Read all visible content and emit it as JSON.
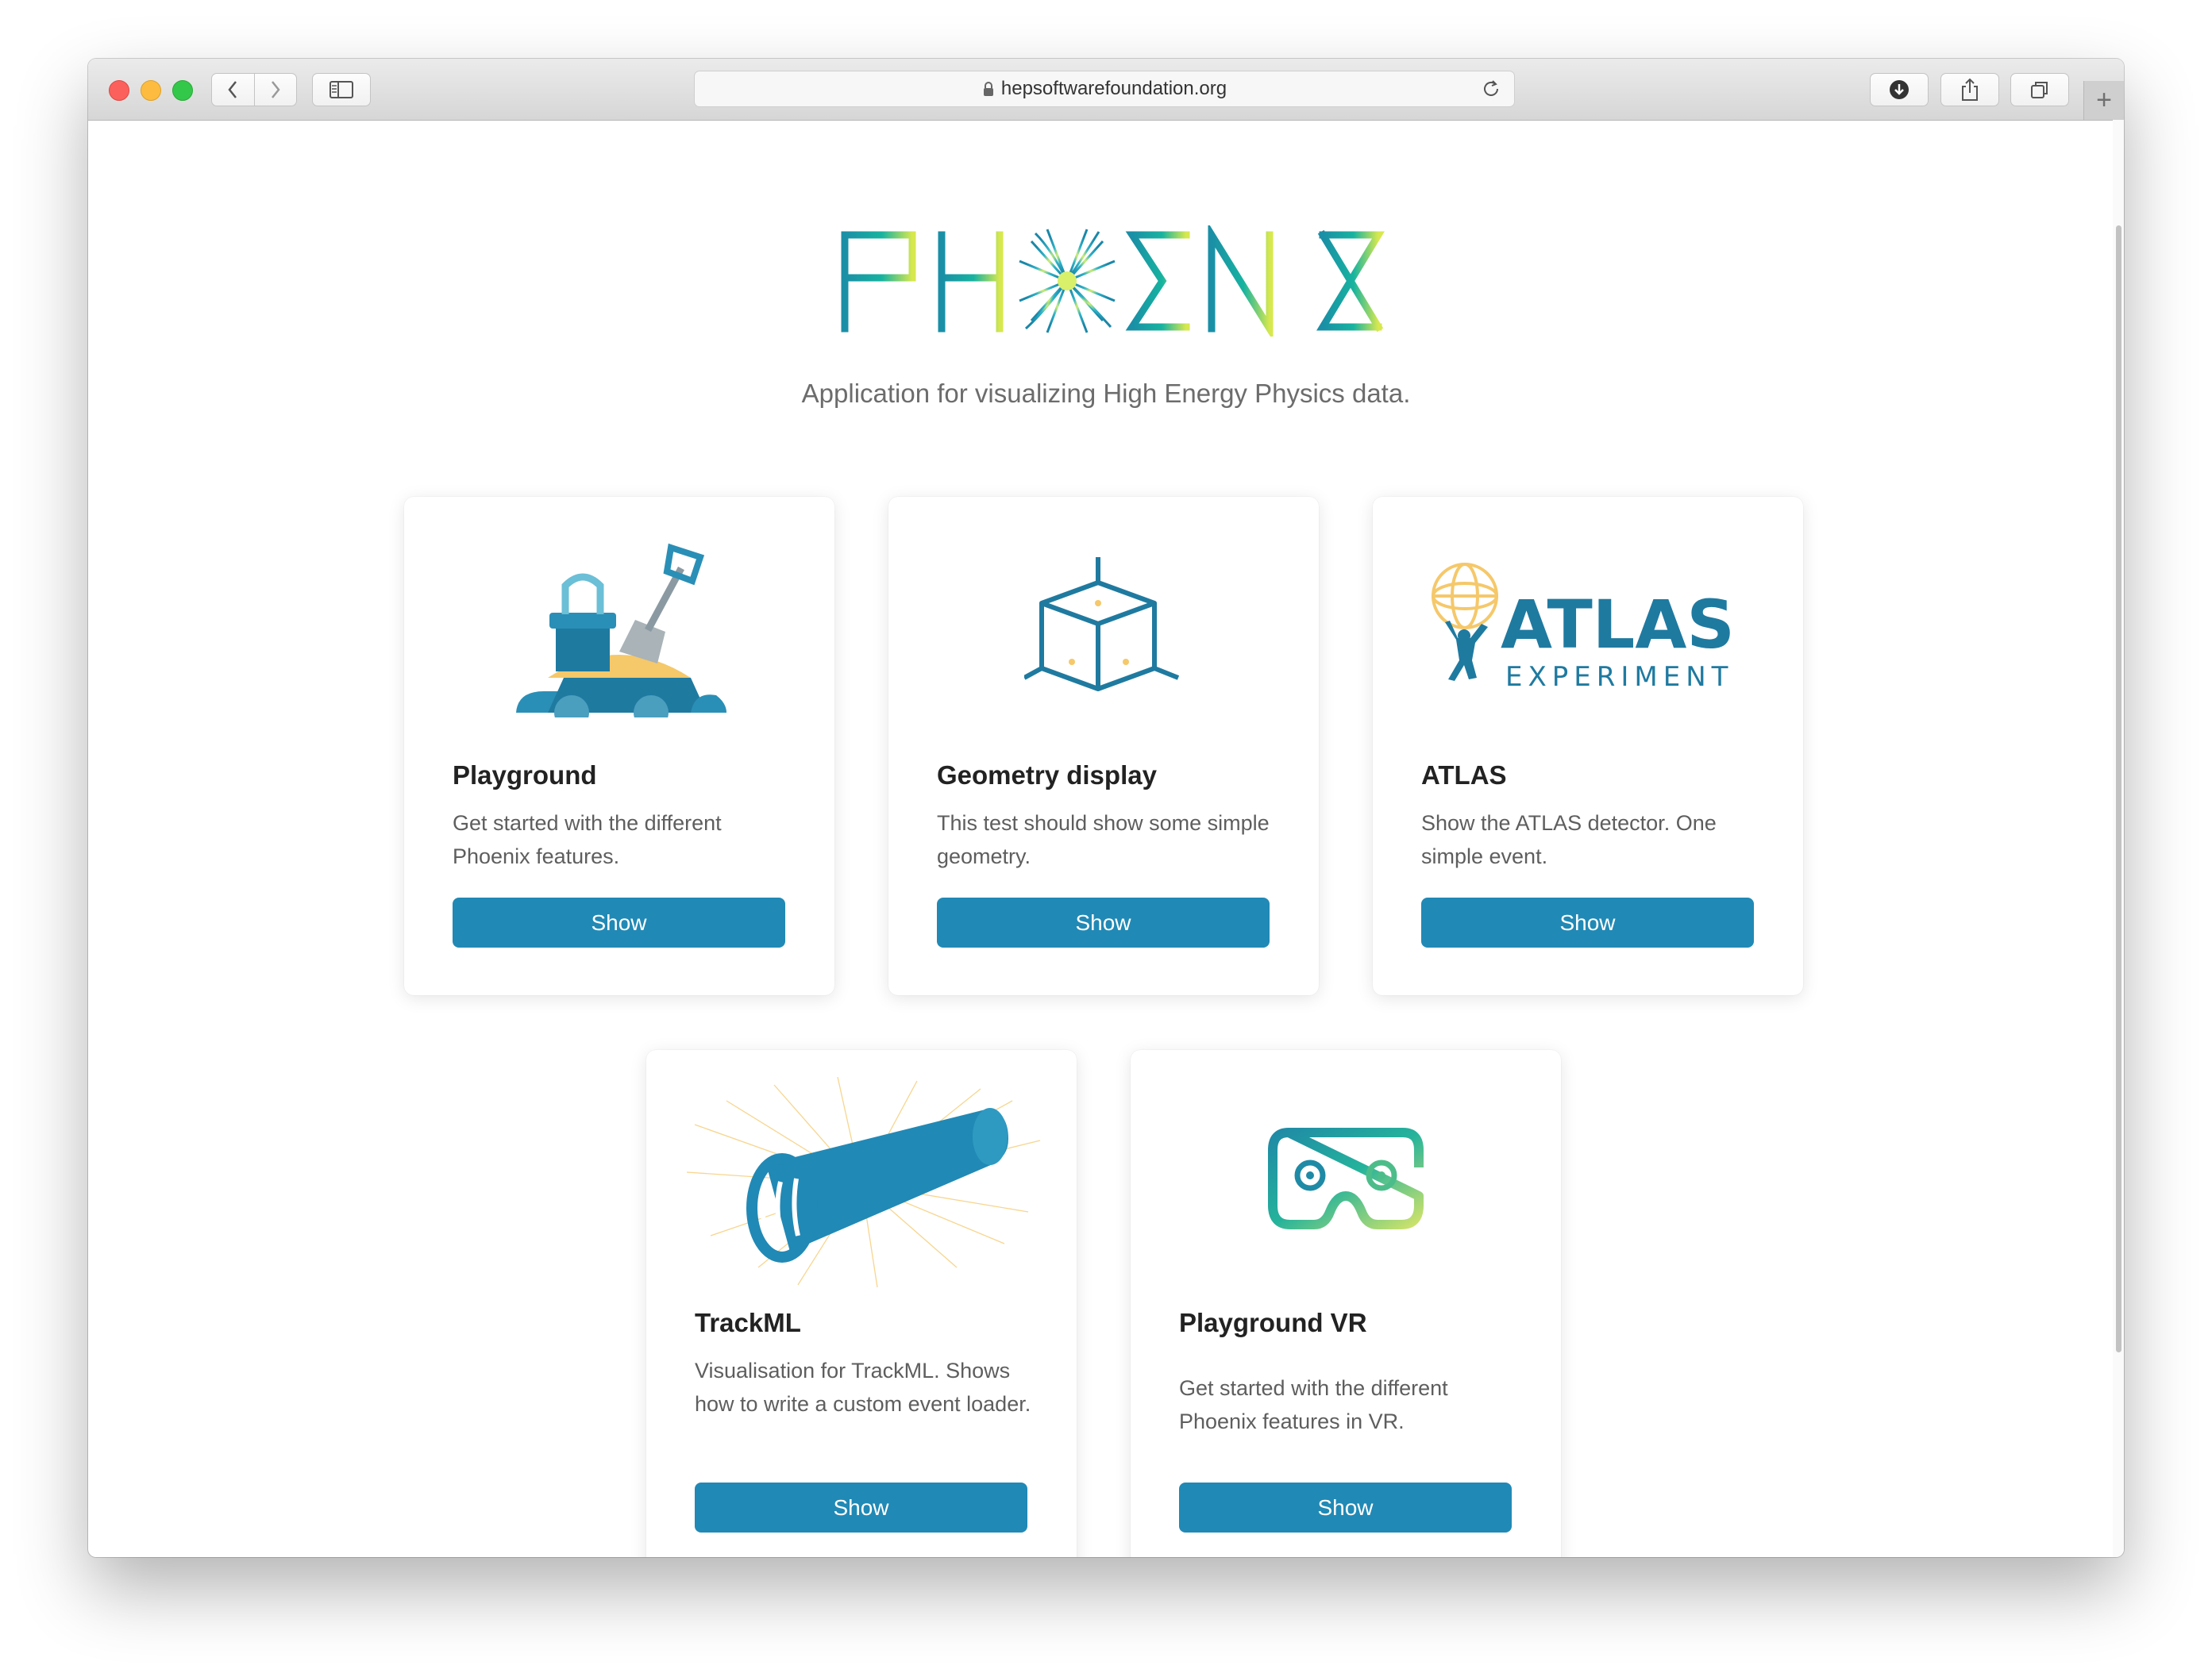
{
  "browser": {
    "url": "hepsoftwarefoundation.org",
    "new_tab_label": "+"
  },
  "page": {
    "logo_text": "PHOENIX",
    "subtitle": "Application for visualizing High Energy Physics data."
  },
  "cards": [
    {
      "title": "Playground",
      "description": "Get started with the different Phoenix features.",
      "button": "Show",
      "icon": "sandbox-icon"
    },
    {
      "title": "Geometry display",
      "description": "This test should show some simple geometry.",
      "button": "Show",
      "icon": "cube-icon"
    },
    {
      "title": "ATLAS",
      "description": "Show the ATLAS detector. One simple event.",
      "button": "Show",
      "icon": "atlas-logo",
      "logo_text_1": "ATLAS",
      "logo_text_2": "EXPERIMENT"
    },
    {
      "title": "TrackML",
      "description": "Visualisation for TrackML. Shows how to write a custom event loader.",
      "button": "Show",
      "icon": "trackml-detector-icon"
    },
    {
      "title": "Playground VR",
      "description": "Get started with the different Phoenix features in VR.",
      "button": "Show",
      "icon": "vr-headset-icon"
    }
  ],
  "colors": {
    "accent": "#2189b5",
    "logo_teal": "#1a93a6",
    "logo_yellow": "#d7e84e"
  }
}
